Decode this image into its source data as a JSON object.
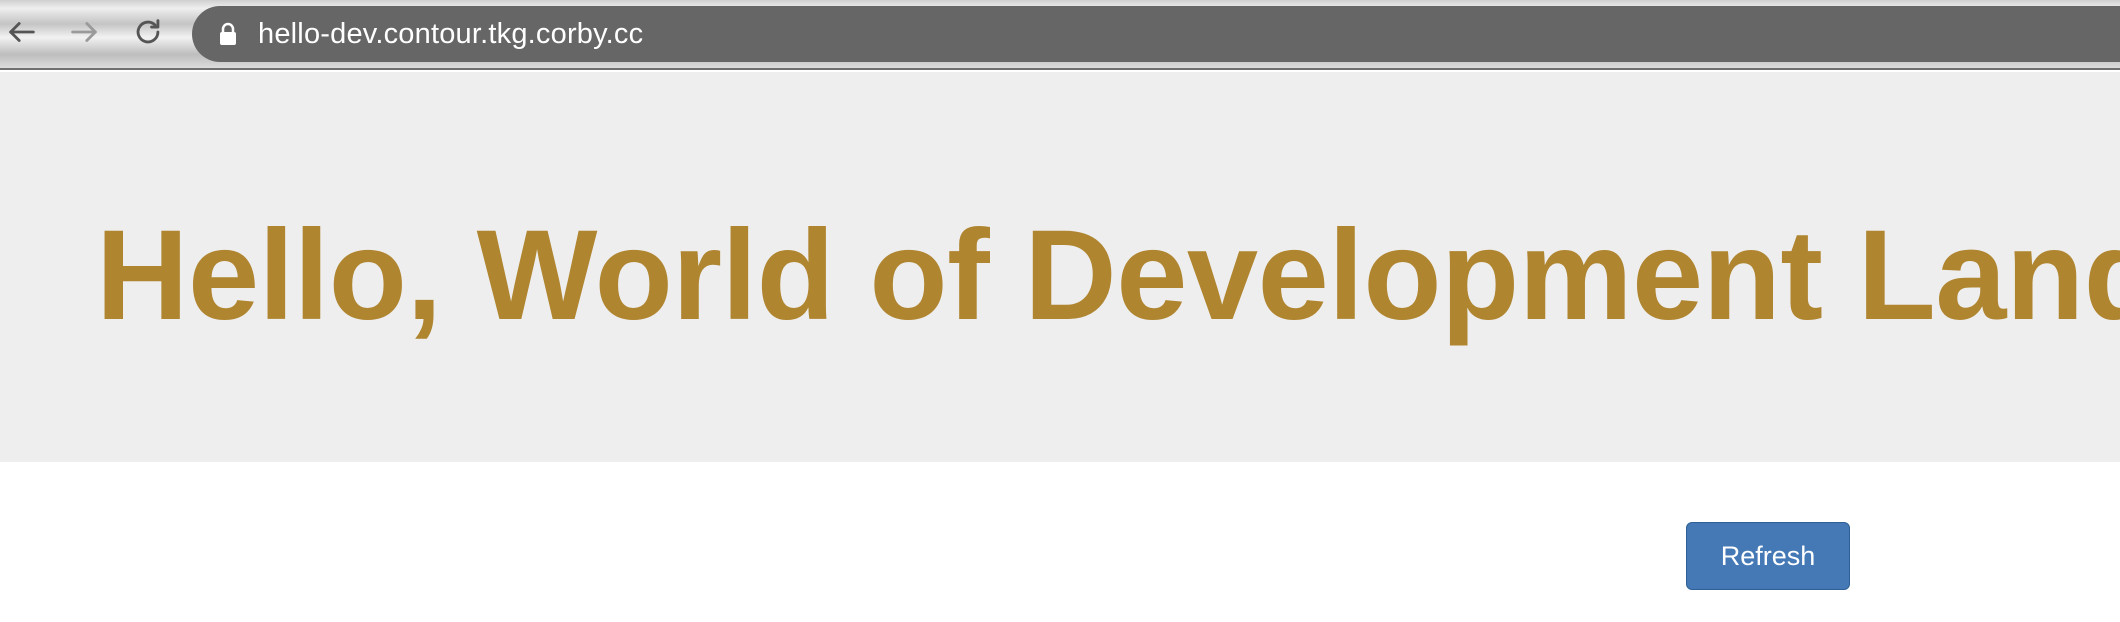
{
  "browser": {
    "url": "hello-dev.contour.tkg.corby.cc",
    "icons": {
      "back": "arrow-left-icon",
      "forward": "arrow-right-icon",
      "reload": "reload-icon",
      "lock": "lock-icon"
    }
  },
  "page": {
    "title": "Hello, World of Development Land",
    "title_color": "#b08530",
    "refresh_label": "Refresh",
    "refresh_color": "#4479b6"
  }
}
